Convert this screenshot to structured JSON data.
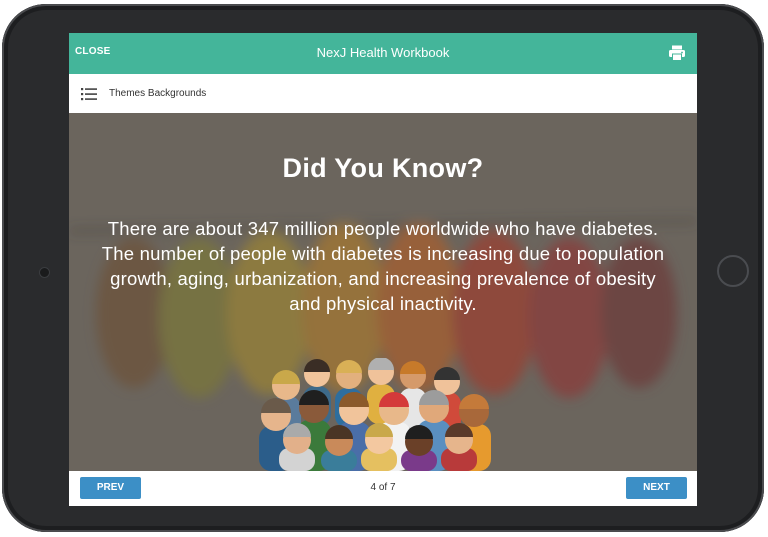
{
  "header": {
    "close_label": "CLOSE",
    "title": "NexJ Health Workbook",
    "print_icon": "printer-icon",
    "color": "#44b59a"
  },
  "toolbar": {
    "menu_icon": "list-icon",
    "label": "Themes Backgrounds"
  },
  "slide": {
    "title": "Did You Know?",
    "body": "There are about 347 million people worldwide who have diabetes. The number of people with diabetes is increasing due to population growth, aging, urbanization, and increasing prevalence of obesity and physical inactivity.",
    "image": "crowd-of-people-illustration"
  },
  "footer": {
    "prev_label": "PREV",
    "next_label": "NEXT",
    "page_indicator": "4 of 7",
    "button_color": "#3c8fc6"
  }
}
